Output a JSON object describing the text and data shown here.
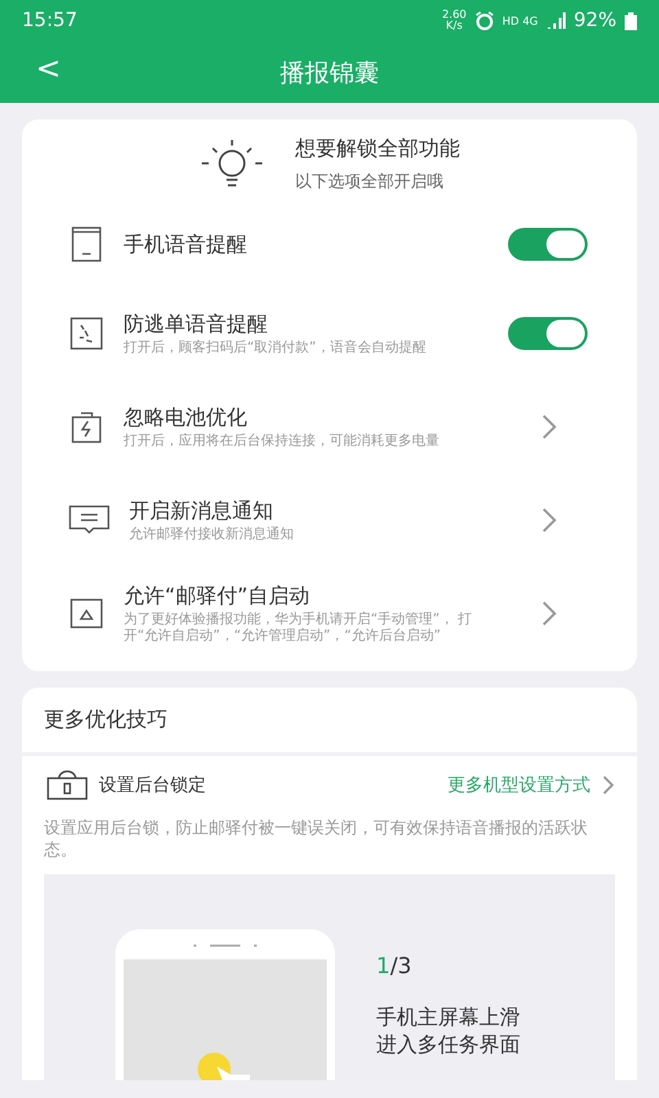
{
  "status_bar": {
    "time": "15:57",
    "speed": "2.60 K/s",
    "network": "HD 4G",
    "battery": "92%"
  },
  "header": {
    "back": "<",
    "title": "播报锦囊"
  },
  "unlock": {
    "title": "想要解锁全部功能",
    "subtitle": "以下选项全部开启哦"
  },
  "settings": [
    {
      "kind": "toggle",
      "title": "手机语音提醒",
      "on": true
    },
    {
      "kind": "toggle",
      "title": "防逃单语音提醒",
      "description": "打开后，顾客扫码后“取消付款”，语音会自动提醒",
      "on": true
    },
    {
      "kind": "link",
      "title": "忽略电池优化",
      "description": "打开后，应用将在后台保持连接，可能消耗更多电量"
    },
    {
      "kind": "link",
      "title": "开启新消息通知",
      "description": "允许邮驿付接收新消息通知"
    },
    {
      "kind": "link",
      "title": "允许“邮驿付”自启动",
      "description": "为了更好体验播报功能，华为手机请开启“手动管理”， 打开“允许自启动”，“允许管理启动”，“允许后台启动”"
    }
  ],
  "tips": {
    "title": "更多优化技巧",
    "lock_label": "设置后台锁定",
    "more_link": "更多机型设置方式",
    "description": "设置应用后台锁，防止邮驿付被一键误关闭，可有效保持语音播报的活跃状态。",
    "step_current": "1",
    "step_total": "/3",
    "step_lines": [
      "手机主屏幕上滑",
      "进入多任务界面"
    ]
  }
}
